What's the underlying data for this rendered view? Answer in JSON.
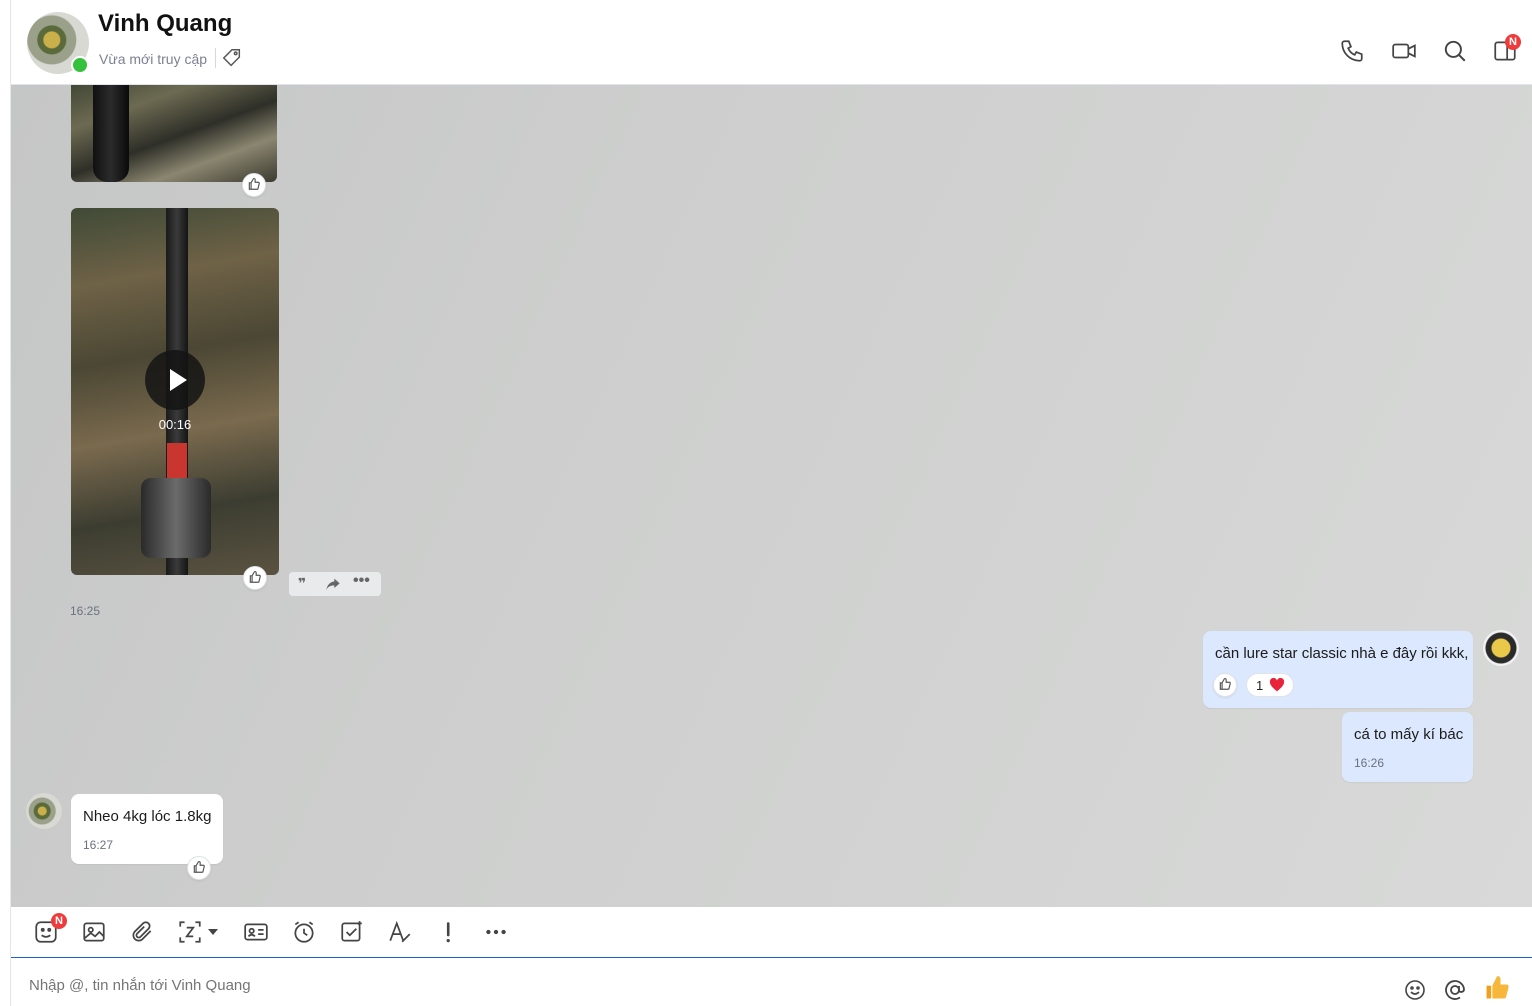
{
  "header": {
    "contact_name": "Vinh Quang",
    "status": "Vừa mới truy cập",
    "notification_badge": "N"
  },
  "messages": {
    "video": {
      "duration": "00:16"
    },
    "group_time": "16:25",
    "outgoing_1": {
      "text": "cần lure star classic nhà e đây rồi kkk,",
      "reaction_count": "1"
    },
    "outgoing_2": {
      "text": "cá to mấy kí bác",
      "time": "16:26"
    },
    "incoming_1": {
      "text": "Nheo 4kg lóc 1.8kg",
      "time": "16:27"
    }
  },
  "toolbar": {
    "sticker_badge": "N"
  },
  "composer": {
    "placeholder": "Nhập @, tin nhắn tới Vinh Quang"
  },
  "colors": {
    "accent": "#1f5fd6",
    "outgoing_bubble": "#dbe8fd",
    "badge": "#ef3b3b",
    "online": "#35c13b"
  }
}
